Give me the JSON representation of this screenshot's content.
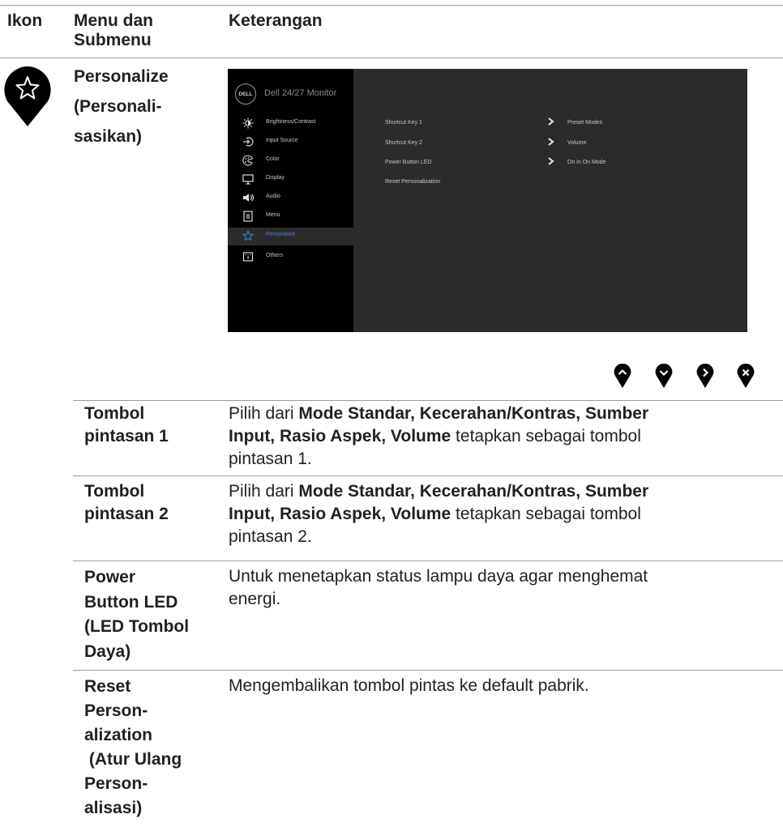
{
  "header": {
    "col1": "Ikon",
    "col2_line1": "Menu dan",
    "col2_line2": "Submenu",
    "col3": "Keterangan"
  },
  "menu_title": {
    "line1": "Personalize",
    "line2": "(Personali-",
    "line3": "sasikan)"
  },
  "osd": {
    "logo": "DELL",
    "title": "Dell 24/27 Monitor",
    "menu_items": [
      {
        "label": "Brightness/Contrast",
        "icon": "brightness-icon"
      },
      {
        "label": "Input Source",
        "icon": "input-source-icon"
      },
      {
        "label": "Color",
        "icon": "color-icon"
      },
      {
        "label": "Display",
        "icon": "display-icon"
      },
      {
        "label": "Audio",
        "icon": "audio-icon"
      },
      {
        "label": "Menu",
        "icon": "menu-icon"
      },
      {
        "label": "Personalize",
        "icon": "star-icon",
        "selected": true
      },
      {
        "label": "Others",
        "icon": "others-icon"
      }
    ],
    "submenu": [
      {
        "label": "Shortcut Key 1",
        "value": "Preset Modes"
      },
      {
        "label": "Shortcut Key 2",
        "value": "Volume"
      },
      {
        "label": "Power Button LED",
        "value": "On in On Mode"
      },
      {
        "label": "Reset Personalization",
        "value": ""
      }
    ],
    "selected_color": "#3a86d6"
  },
  "nav_buttons": [
    "up-button-icon",
    "down-button-icon",
    "right-button-icon",
    "close-button-icon"
  ],
  "rows": [
    {
      "label_lines": [
        "Tombol",
        "pintasan 1"
      ],
      "desc_pre": "Pilih dari ",
      "desc_bold1": "Mode Standar, Kecerahan/Kontras, Sumber",
      "desc_bold2": "Input, Rasio Aspek, Volume",
      "desc_post2": " tetapkan sebagai tombol",
      "desc_line3": "pintasan 1."
    },
    {
      "label_lines": [
        "Tombol",
        "pintasan 2"
      ],
      "desc_pre": "Pilih dari ",
      "desc_bold1": "Mode Standar, Kecerahan/Kontras, Sumber",
      "desc_bold2": "Input, Rasio Aspek, Volume",
      "desc_post2": " tetapkan sebagai tombol",
      "desc_line3": "pintasan 2."
    },
    {
      "label_lines": [
        "Power",
        "Button LED",
        "(LED Tombol",
        "Daya)"
      ],
      "desc_lines": [
        "Untuk menetapkan status lampu daya agar menghemat",
        "energi."
      ]
    },
    {
      "label_lines": [
        "Reset",
        "Person-",
        "alization",
        " (Atur Ulang",
        "Person-",
        "alisasi)"
      ],
      "desc_lines": [
        "Mengembalikan tombol pintas ke default pabrik."
      ]
    }
  ]
}
